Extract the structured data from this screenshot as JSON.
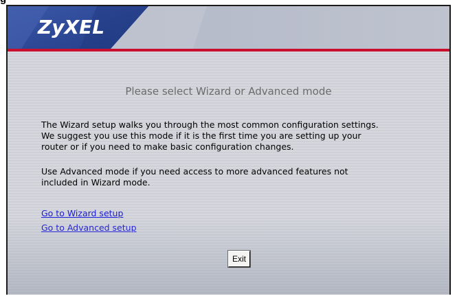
{
  "caption_fragment": "g",
  "header": {
    "logo_text": "ZyXEL"
  },
  "main": {
    "title": "Please select Wizard or Advanced mode",
    "paragraph1": "The Wizard setup walks you through the most common configuration settings.\nWe suggest you use this mode if it is the first time you are setting up your\nrouter or if you need to make basic configuration changes.",
    "paragraph2": "Use Advanced mode if you need access to more advanced features not\nincluded in Wizard mode.",
    "links": {
      "wizard": "Go to Wizard setup",
      "advanced": "Go to Advanced setup"
    },
    "exit_label": "Exit"
  },
  "colors": {
    "header_blue": "#2f4a9a",
    "accent_red": "#c8102e",
    "link_blue": "#1a1adb",
    "title_gray": "#6b6b6b"
  }
}
